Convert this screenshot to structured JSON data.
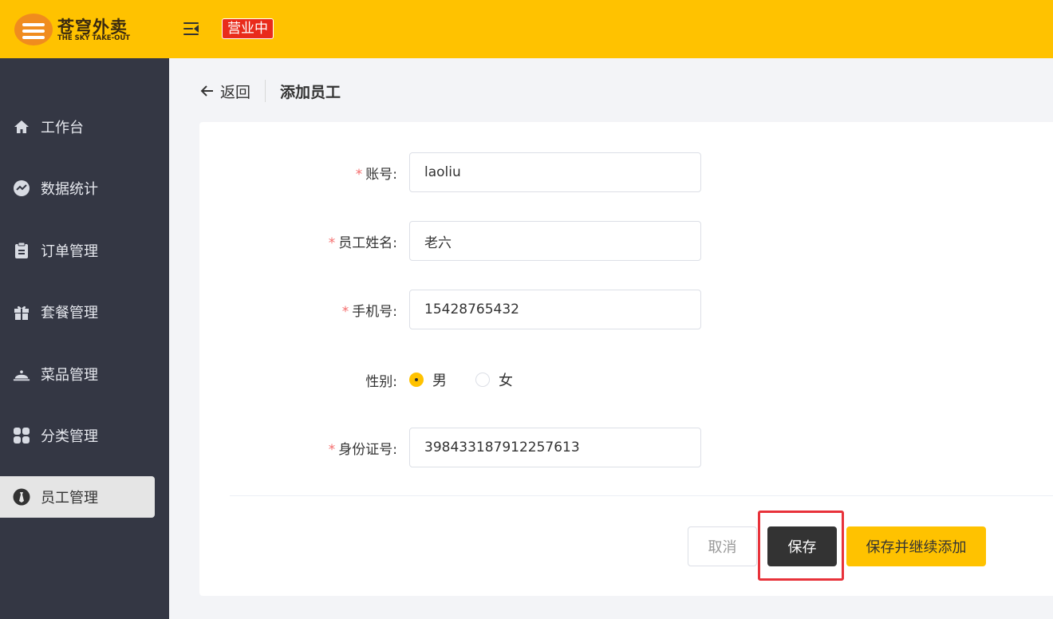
{
  "header": {
    "logo_cn": "苍穹外卖",
    "logo_en": "THE SKY TAKE-OUT",
    "status": "营业中",
    "accent_color": "#ffc200",
    "status_color": "#e92b1b"
  },
  "sidebar": {
    "items": [
      {
        "label": "工作台",
        "icon": "home-icon"
      },
      {
        "label": "数据统计",
        "icon": "chart-icon"
      },
      {
        "label": "订单管理",
        "icon": "clipboard-icon"
      },
      {
        "label": "套餐管理",
        "icon": "gift-icon"
      },
      {
        "label": "菜品管理",
        "icon": "cloche-icon"
      },
      {
        "label": "分类管理",
        "icon": "grid-icon"
      },
      {
        "label": "员工管理",
        "icon": "employee-icon",
        "active": true
      }
    ]
  },
  "breadcrumb": {
    "back_label": "返回",
    "title": "添加员工"
  },
  "form": {
    "username": {
      "label": "账号:",
      "value": "laoliu",
      "required": true
    },
    "name": {
      "label": "员工姓名:",
      "value": "老六",
      "required": true
    },
    "phone": {
      "label": "手机号:",
      "value": "15428765432",
      "required": true
    },
    "gender": {
      "label": "性别:",
      "options": [
        "男",
        "女"
      ],
      "selected": "男"
    },
    "id_number": {
      "label": "身份证号:",
      "value": "398433187912257613",
      "required": true
    }
  },
  "buttons": {
    "cancel": "取消",
    "save": "保存",
    "save_continue": "保存并继续添加"
  }
}
